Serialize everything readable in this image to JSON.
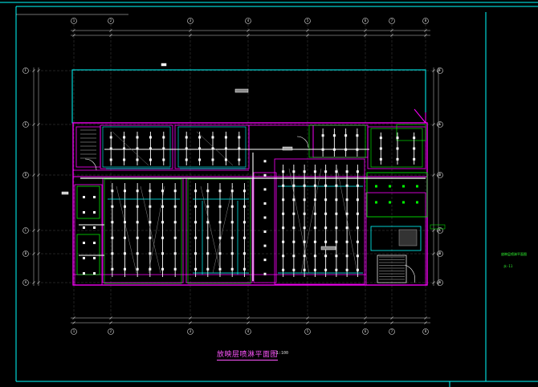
{
  "drawing": {
    "title": "放映层喷淋平面图",
    "scale": "1:100"
  },
  "title_block": {
    "name": "放映层喷淋平面图",
    "sheet_no": "水-11"
  },
  "axis_labels": {
    "top": [
      "1",
      "2",
      "3",
      "4",
      "5",
      "6",
      "7",
      "8"
    ],
    "bottom": [
      "1",
      "2",
      "3",
      "4",
      "5",
      "6",
      "7",
      "8"
    ],
    "left": [
      "F",
      "E",
      "D",
      "C",
      "B",
      "A"
    ]
  },
  "colors": {
    "background": "#000000",
    "frame": "#00ffff",
    "walls": "#ff00ff",
    "sprinkler_pipe": "#ffffff",
    "branch_pipe": "#00ffff",
    "green": "#00ff00",
    "dimension": "#cccccc"
  }
}
